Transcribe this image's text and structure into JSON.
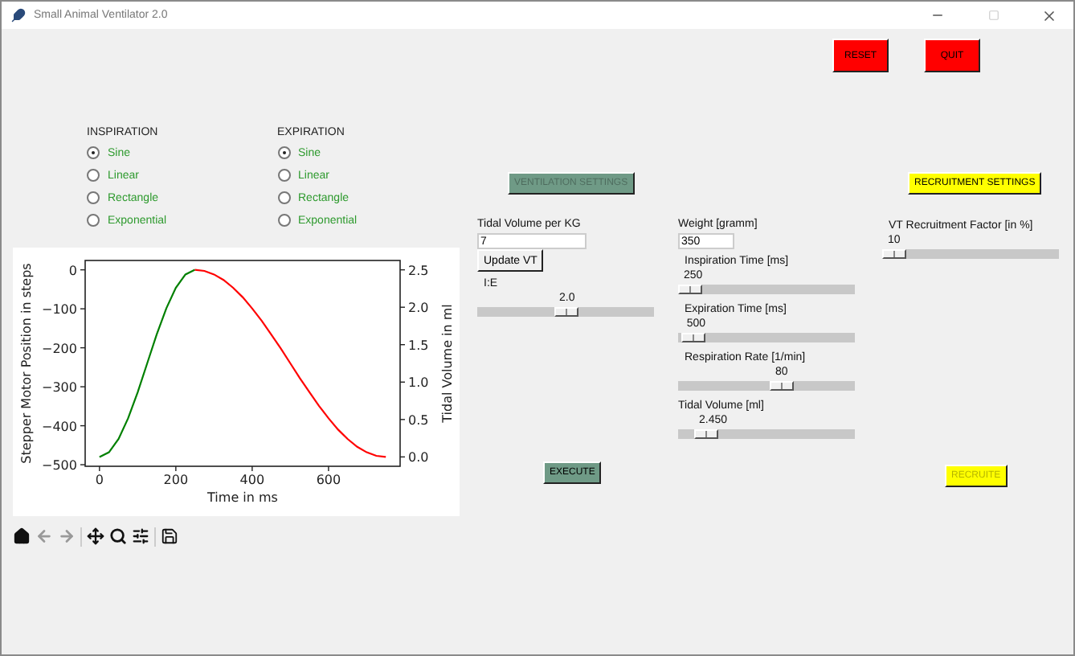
{
  "window": {
    "title": "Small Animal Ventilator 2.0"
  },
  "top_buttons": [
    {
      "label": "RESET",
      "color": "#ff0000",
      "disabled": false
    },
    {
      "label": "QUIT",
      "color": "#ff0000",
      "disabled": false
    }
  ],
  "inspiration": {
    "title": "INSPIRATION",
    "options": [
      {
        "label": "Sine",
        "selected": true
      },
      {
        "label": "Linear",
        "selected": false
      },
      {
        "label": "Rectangle",
        "selected": false
      },
      {
        "label": "Exponential",
        "selected": false
      }
    ]
  },
  "expiration": {
    "title": "EXPIRATION",
    "options": [
      {
        "label": "Sine",
        "selected": true
      },
      {
        "label": "Linear",
        "selected": false
      },
      {
        "label": "Rectangle",
        "selected": false
      },
      {
        "label": "Exponential",
        "selected": false
      }
    ]
  },
  "plot": {
    "chart_data": {
      "type": "line",
      "xlabel": "Time in ms",
      "ylabel": "Stepper Motor Position in steps",
      "y2label": "Tidal Volume in ml",
      "x": [
        0,
        25,
        50,
        75,
        100,
        125,
        150,
        175,
        200,
        225,
        250,
        275,
        300,
        325,
        350,
        375,
        400,
        425,
        450,
        475,
        500,
        525,
        550,
        575,
        600,
        625,
        650,
        675,
        700,
        725,
        750
      ],
      "series": [
        {
          "color": "#008000",
          "values": [
            -480,
            -468,
            -434,
            -381,
            -314,
            -240,
            -166,
            -99,
            -46,
            -12,
            0,
            null,
            null,
            null,
            null,
            null,
            null,
            null,
            null,
            null,
            null,
            null,
            null,
            null,
            null,
            null,
            null,
            null,
            null,
            null,
            null
          ]
        },
        {
          "color": "#ff0000",
          "values": [
            null,
            null,
            null,
            null,
            null,
            null,
            null,
            null,
            null,
            null,
            0,
            -3,
            -12,
            -26,
            -46,
            -70,
            -99,
            -131,
            -166,
            -202,
            -240,
            -278,
            -314,
            -349,
            -381,
            -410,
            -434,
            -454,
            -468,
            -477,
            -480
          ]
        }
      ],
      "xlim": [
        -37.5,
        787.5
      ],
      "ylim": [
        -504,
        24
      ],
      "y2lim": [
        -0.125,
        2.625
      ],
      "xticks": [
        0,
        200,
        400,
        600
      ],
      "yticks": [
        {
          "value": 0,
          "label": "0"
        },
        {
          "value": -100,
          "label": "−100"
        },
        {
          "value": -200,
          "label": "−200"
        },
        {
          "value": -300,
          "label": "−300"
        },
        {
          "value": -400,
          "label": "−400"
        },
        {
          "value": -500,
          "label": "−500"
        }
      ],
      "y2ticks": [
        {
          "value": 0,
          "label": "0.0"
        },
        {
          "value": 0.5,
          "label": "0.5"
        },
        {
          "value": 1,
          "label": "1.0"
        },
        {
          "value": 1.5,
          "label": "1.5"
        },
        {
          "value": 2,
          "label": "2.0"
        },
        {
          "value": 2.5,
          "label": "2.5"
        }
      ]
    }
  },
  "ventilation": {
    "button": {
      "label": "VENTILATION SETTINGS",
      "color": "#6f9a86",
      "disabled": true
    },
    "tidal_volume_per_kg": {
      "label": "Tidal Volume per KG",
      "value": "7"
    },
    "update_button": "Update VT",
    "ie": {
      "label": "I:E",
      "reading": "2.0",
      "level": 0.5
    },
    "execute_button": {
      "label": "EXECUTE",
      "color": "#6f9a86",
      "disabled": false
    }
  },
  "weight": {
    "label": "Weight [gramm]",
    "value": "350"
  },
  "sliders": [
    {
      "label": "Inspiration Time [ms]",
      "reading": "250",
      "level": 0.0
    },
    {
      "label": "Expiration Time [ms]",
      "reading": "500",
      "level": 0.02
    },
    {
      "label": "Respiration Rate [1/min]",
      "reading": "80",
      "level": 0.6
    },
    {
      "label": "Tidal Volume [ml]",
      "reading": "2.450",
      "level": 0.1
    }
  ],
  "recruitment": {
    "button": {
      "label": "RECRUITMENT SETTINGS",
      "color": "#ffff00",
      "disabled": false
    },
    "factor": {
      "label": "VT Recruitment Factor [in %]",
      "reading": "10",
      "level": 0.0
    },
    "recruite_button": {
      "label": "RECRUITE",
      "color": "#ffff00",
      "disabled": true
    }
  }
}
